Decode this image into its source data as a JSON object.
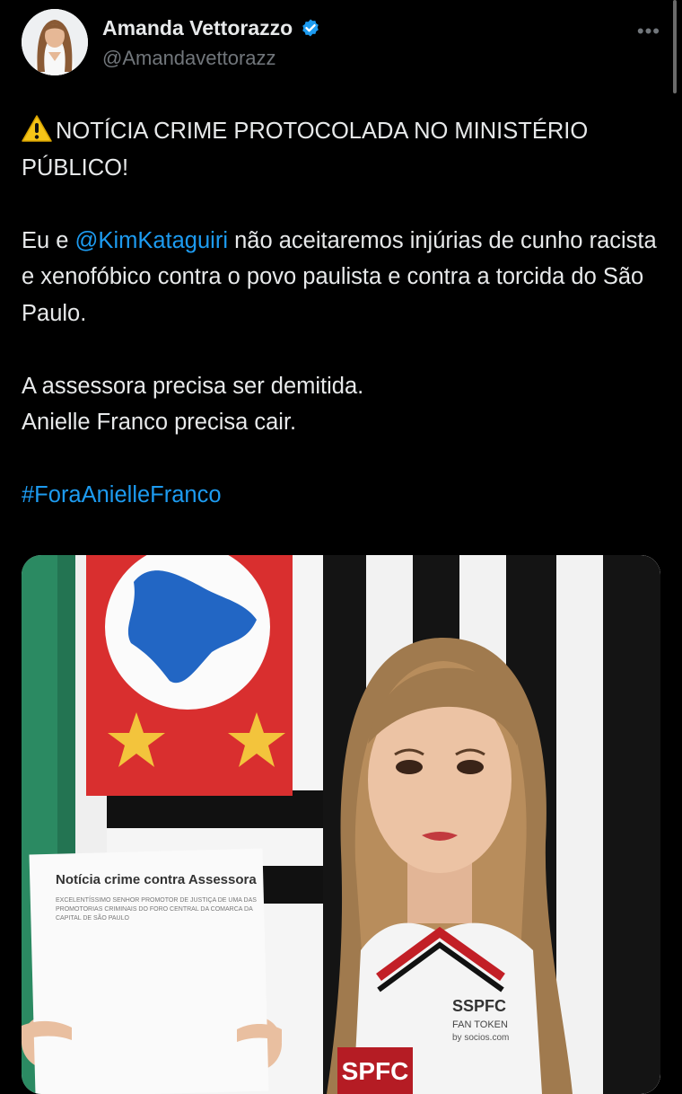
{
  "author": {
    "display_name": "Amanda Vettorazzo",
    "handle": "@Amandavettorazz",
    "verified_icon": "verified-badge-icon",
    "avatar_icon": "avatar"
  },
  "menu": {
    "more_label": "•••"
  },
  "tweet": {
    "line1_text": "NOTÍCIA CRIME PROTOCOLADA NO MINISTÉRIO PÚBLICO!",
    "para2_prefix": "Eu e ",
    "mention": "@KimKataguiri",
    "para2_suffix": " não aceitaremos injúrias de cunho racista e xenofóbico contra o povo paulista e contra a torcida do São Paulo.",
    "para3_line1": "A assessora precisa ser demitida.",
    "para3_line2": "Anielle Franco precisa cair.",
    "hashtag": "#ForaAnielleFranco"
  },
  "media": {
    "doc_title": "Notícia crime contra Assessora",
    "doc_body_1": "EXCELENTÍSSIMO SENHOR PROMOTOR DE JUSTIÇA DE UMA DAS",
    "doc_body_2": "PROMOTORIAS CRIMINAIS DO FORO CENTRAL DA COMARCA DA",
    "doc_body_3": "CAPITAL DE SÃO PAULO",
    "jersey_text_1": "SSPFC",
    "jersey_text_2": "FAN TOKEN",
    "jersey_text_3": "by socios.com",
    "jersey_crest": "SPFC"
  },
  "colors": {
    "background": "#000000",
    "text": "#e7e9ea",
    "secondary": "#71767b",
    "link": "#1d9bf0",
    "verified": "#1d9bf0"
  }
}
